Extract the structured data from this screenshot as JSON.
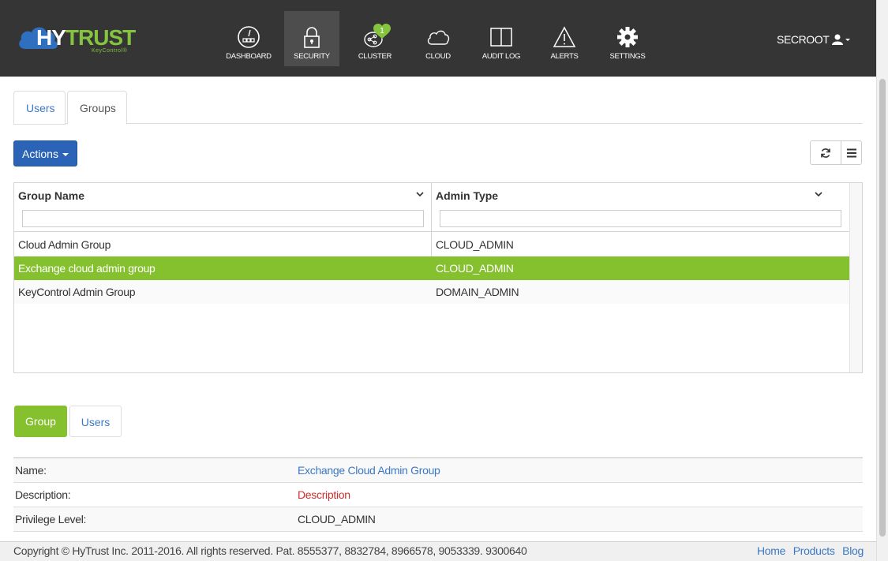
{
  "brand": {
    "name_left": "HY",
    "name_right": "TRUST",
    "subtitle": "KeyControl®",
    "color_green": "#85c43e",
    "color_blue": "#2b64b6"
  },
  "nav": {
    "items": [
      {
        "label": "DASHBOARD",
        "icon": "dashboard-icon",
        "active": false
      },
      {
        "label": "SECURITY",
        "icon": "lock-icon",
        "active": true
      },
      {
        "label": "CLUSTER",
        "icon": "cluster-icon",
        "active": false,
        "badge": "1"
      },
      {
        "label": "CLOUD",
        "icon": "cloud-icon",
        "active": false
      },
      {
        "label": "AUDIT LOG",
        "icon": "book-icon",
        "active": false
      },
      {
        "label": "ALERTS",
        "icon": "warning-icon",
        "active": false
      },
      {
        "label": "SETTINGS",
        "icon": "gear-icon",
        "active": false
      }
    ],
    "user": "SECROOT"
  },
  "tabs": {
    "users": "Users",
    "groups": "Groups",
    "active": "Groups"
  },
  "toolbar": {
    "actions_label": "Actions"
  },
  "grid": {
    "columns": [
      {
        "title": "Group Name",
        "filter": ""
      },
      {
        "title": "Admin Type",
        "filter": ""
      }
    ],
    "rows": [
      {
        "group": "Cloud Admin Group",
        "type": "CLOUD_ADMIN",
        "selected": false
      },
      {
        "group": "Exchange cloud admin group",
        "type": "CLOUD_ADMIN",
        "selected": true
      },
      {
        "group": "KeyControl Admin Group",
        "type": "DOMAIN_ADMIN",
        "selected": false
      }
    ],
    "selected_color": "#85c12e"
  },
  "detail_tabs": {
    "group": "Group",
    "users": "Users",
    "active": "Group"
  },
  "detail": {
    "name_key": "Name:",
    "name_value": "Exchange Cloud Admin Group",
    "desc_key": "Description:",
    "desc_value": "Description",
    "priv_key": "Privilege Level:",
    "priv_value": "CLOUD_ADMIN"
  },
  "footer": {
    "copyright": "Copyright © HyTrust Inc. 2011-2016. All rights reserved. Pat. 8555377, 8832784, 8966578, 9053339. 9300640",
    "links": [
      "Home",
      "Products",
      "Blog"
    ]
  }
}
